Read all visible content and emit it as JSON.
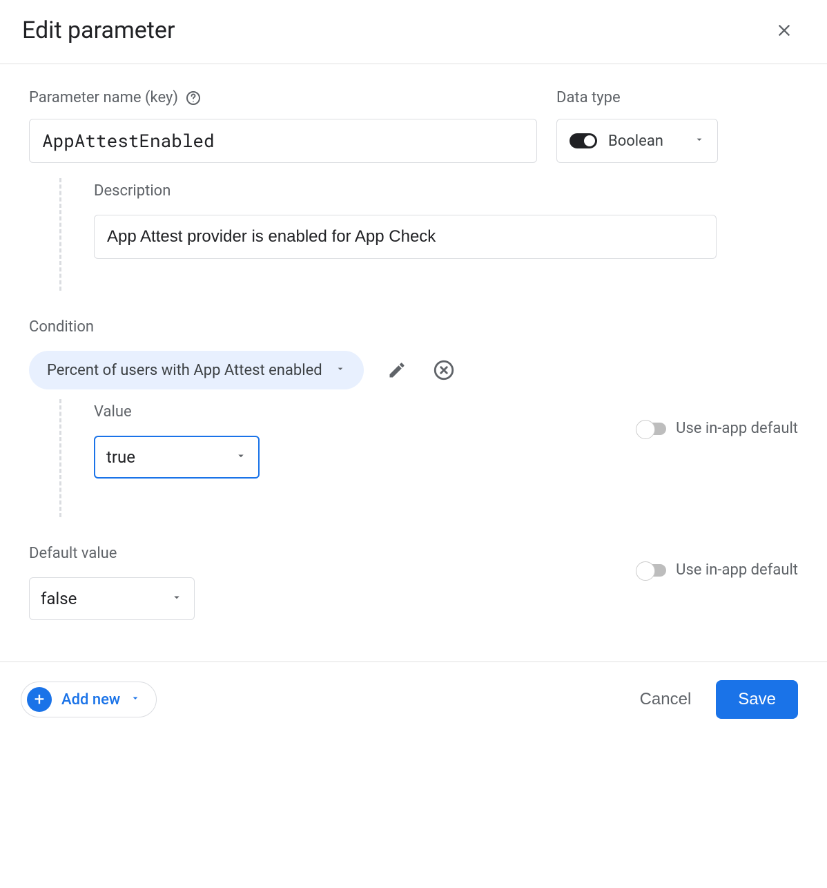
{
  "header": {
    "title": "Edit parameter"
  },
  "param_name": {
    "label": "Parameter name (key)",
    "value": "AppAttestEnabled"
  },
  "data_type": {
    "label": "Data type",
    "selected": "Boolean"
  },
  "description": {
    "label": "Description",
    "value": "App Attest provider is enabled for App Check"
  },
  "condition": {
    "label": "Condition",
    "chip_label": "Percent of users with App Attest enabled",
    "value_label": "Value",
    "value_selected": "true",
    "use_in_app_default_label": "Use in-app default"
  },
  "default": {
    "label": "Default value",
    "value_selected": "false",
    "use_in_app_default_label": "Use in-app default"
  },
  "footer": {
    "add_new_label": "Add new",
    "cancel_label": "Cancel",
    "save_label": "Save"
  }
}
